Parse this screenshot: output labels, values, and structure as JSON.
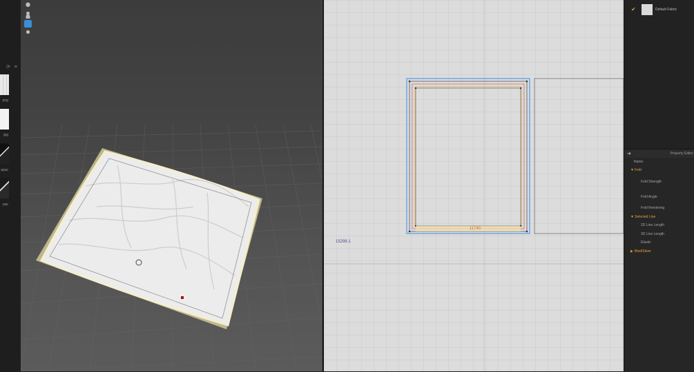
{
  "library": {
    "thumb_labels": [
      "png",
      "jpg",
      "apac",
      "pac"
    ]
  },
  "viewport2d": {
    "segment_length_label": "11740",
    "coordinate_readout": "15298.1"
  },
  "object_browser": {
    "fabric_name": "Default Fabric"
  },
  "property_editor": {
    "title": "Property Editor",
    "rows": {
      "name": "Name",
      "fold": "Fold",
      "fold_strength": "Fold Strength",
      "fold_angle": "Fold Angle",
      "fold_rendering": "Fold Rendering",
      "selected_line": "Selected Line",
      "line_2d": "2D Line Length",
      "line_3d": "3D Line Length",
      "elastic": "Elastic",
      "bind_silver": "Bind/Silver"
    }
  },
  "colors": {
    "accent": "#e0a43a",
    "selection_blue": "#6aa8e6",
    "pattern_red": "#d07060"
  }
}
